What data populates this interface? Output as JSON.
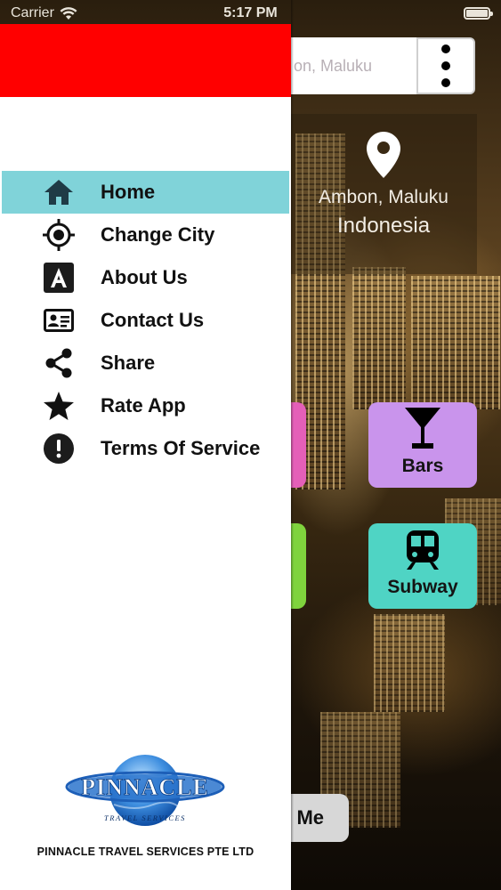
{
  "status_bar": {
    "carrier": "Carrier",
    "time": "5:17 PM"
  },
  "background": {
    "search_placeholder": "Ambon, Maluku",
    "search_visible": "on, Maluku",
    "location_city": "Ambon, Maluku",
    "location_country": "Indonesia",
    "tiles": {
      "bars_label": "Bars",
      "subway_label": "Subway"
    },
    "me_button_label": "Me"
  },
  "drawer": {
    "header_color": "#ff0000",
    "active_color": "#80d3d9",
    "items": [
      {
        "label": "Home",
        "icon": "home-icon",
        "active": true
      },
      {
        "label": "Change City",
        "icon": "location-target-icon",
        "active": false
      },
      {
        "label": "About Us",
        "icon": "letter-a-icon",
        "active": false
      },
      {
        "label": "Contact Us",
        "icon": "contact-card-icon",
        "active": false
      },
      {
        "label": "Share",
        "icon": "share-icon",
        "active": false
      },
      {
        "label": "Rate App",
        "icon": "star-icon",
        "active": false
      },
      {
        "label": "Terms Of Service",
        "icon": "exclamation-circle-icon",
        "active": false
      }
    ],
    "logo_text": "PINNACLE",
    "logo_subtext": "TRAVEL SERVICES",
    "company_name": "PINNACLE TRAVEL SERVICES PTE LTD"
  }
}
